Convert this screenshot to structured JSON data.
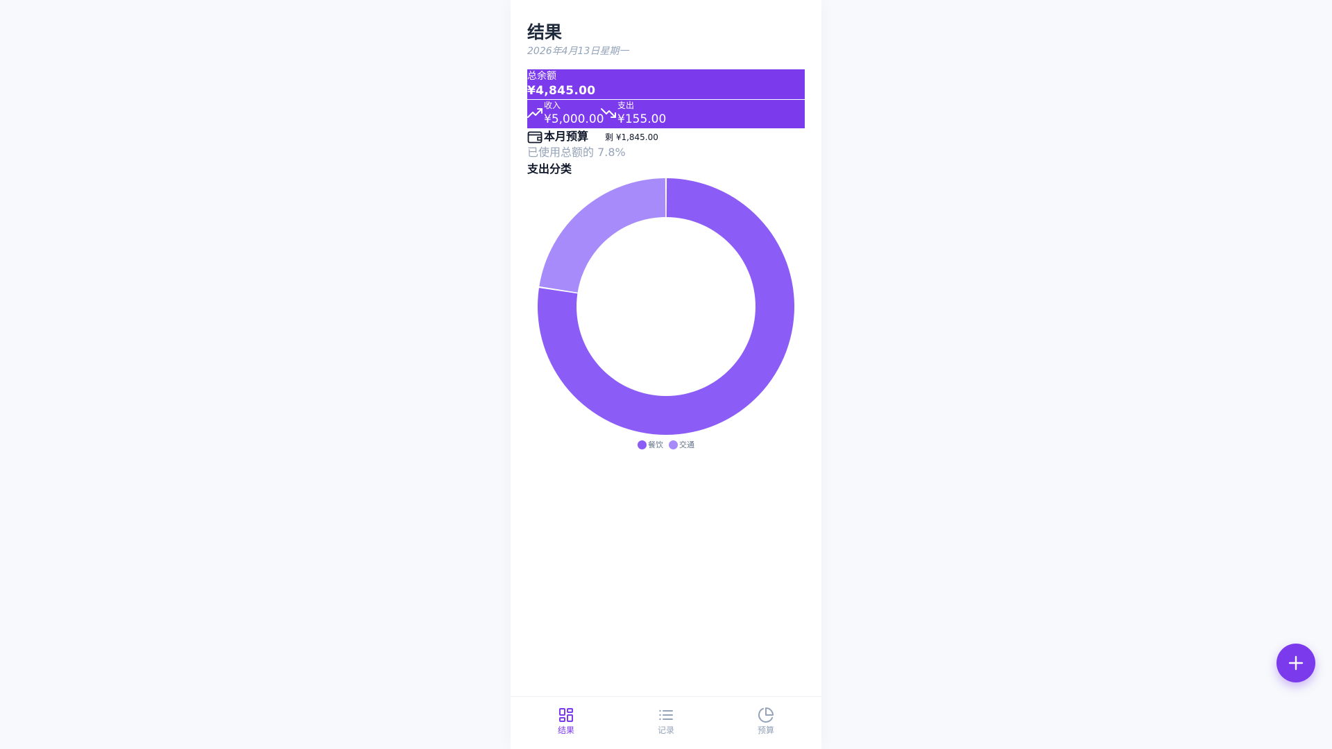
{
  "header": {
    "title": "结果",
    "date": "2026年4月13日星期一"
  },
  "balance": {
    "label": "总余额",
    "value": "¥4,845.00"
  },
  "income": {
    "label": "收入",
    "value": "¥5,000.00",
    "icon": "trending-up-icon"
  },
  "expense": {
    "label": "支出",
    "value": "¥155.00",
    "icon": "trending-down-icon"
  },
  "budget": {
    "title": "本月预算",
    "remaining": "剩 ¥1,845.00",
    "used_text": "已使用总额的 7.8%",
    "icon": "wallet-icon"
  },
  "breakdown": {
    "title": "支出分类"
  },
  "chart_data": {
    "type": "pie",
    "donut": true,
    "categories": [
      "餐饮",
      "交通"
    ],
    "values": [
      120,
      35
    ],
    "colors": [
      "#8b5cf6",
      "#a78bfa"
    ],
    "legend": "bottom-center"
  },
  "nav": {
    "items": [
      {
        "label": "结果",
        "icon": "grid-icon",
        "active": true
      },
      {
        "label": "记录",
        "icon": "list-icon",
        "active": false
      },
      {
        "label": "预算",
        "icon": "pie-chart-icon",
        "active": false
      }
    ]
  },
  "colors": {
    "accent": "#7c3aed",
    "nav_active": "#7c3aed",
    "nav_inactive": "#94a3b8",
    "muted": "#94a3b8"
  },
  "fab": {
    "icon": "plus-icon"
  }
}
